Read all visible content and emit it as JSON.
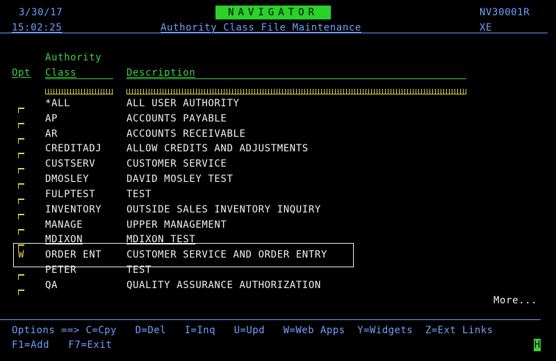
{
  "header": {
    "date": "3/30/17",
    "time": "15:02:25",
    "app_title": "NAVIGATOR",
    "screen_title": "Authority Class File Maintenance",
    "program_id": "NV30001R",
    "env": "XE"
  },
  "columns": {
    "opt": "Opt",
    "class_top": "Authority",
    "class_bottom": "Class",
    "description": "Description"
  },
  "rows": [
    {
      "opt": "",
      "class": "*ALL",
      "description": "ALL USER AUTHORITY"
    },
    {
      "opt": "",
      "class": "AP",
      "description": "ACCOUNTS PAYABLE"
    },
    {
      "opt": "",
      "class": "AR",
      "description": "ACCOUNTS RECEIVABLE"
    },
    {
      "opt": "",
      "class": "CREDITADJ",
      "description": "ALLOW CREDITS AND ADJUSTMENTS"
    },
    {
      "opt": "",
      "class": "CUSTSERV",
      "description": "CUSTOMER SERVICE"
    },
    {
      "opt": "",
      "class": "DMOSLEY",
      "description": "DAVID MOSLEY TEST"
    },
    {
      "opt": "",
      "class": "FULPTEST",
      "description": "TEST"
    },
    {
      "opt": "",
      "class": "INVENTORY",
      "description": "OUTSIDE SALES INVENTORY INQUIRY"
    },
    {
      "opt": "",
      "class": "MANAGE",
      "description": "UPPER MANAGEMENT"
    },
    {
      "opt": "",
      "class": "MDIXON",
      "description": "MDIXON TEST"
    },
    {
      "opt": "W",
      "class": "ORDER ENT",
      "description": "CUSTOMER SERVICE AND ORDER ENTRY"
    },
    {
      "opt": "",
      "class": "PETER",
      "description": "TEST"
    },
    {
      "opt": "",
      "class": "QA",
      "description": "QUALITY ASSURANCE AUTHORIZATION"
    }
  ],
  "more": "More...",
  "footer": {
    "options_line": "Options ==> C=Cpy   D=Del   I=Inq   U=Upd   W=Web Apps  Y=Widgets  Z=Ext Links",
    "keys_line": "F1=Add   F7=Exit",
    "cursor_char": "H"
  },
  "colors": {
    "background": "#000000",
    "blue": "#6fa0ff",
    "green": "#3fd23f",
    "white": "#f2f2f2",
    "yellow": "#e6d640"
  }
}
